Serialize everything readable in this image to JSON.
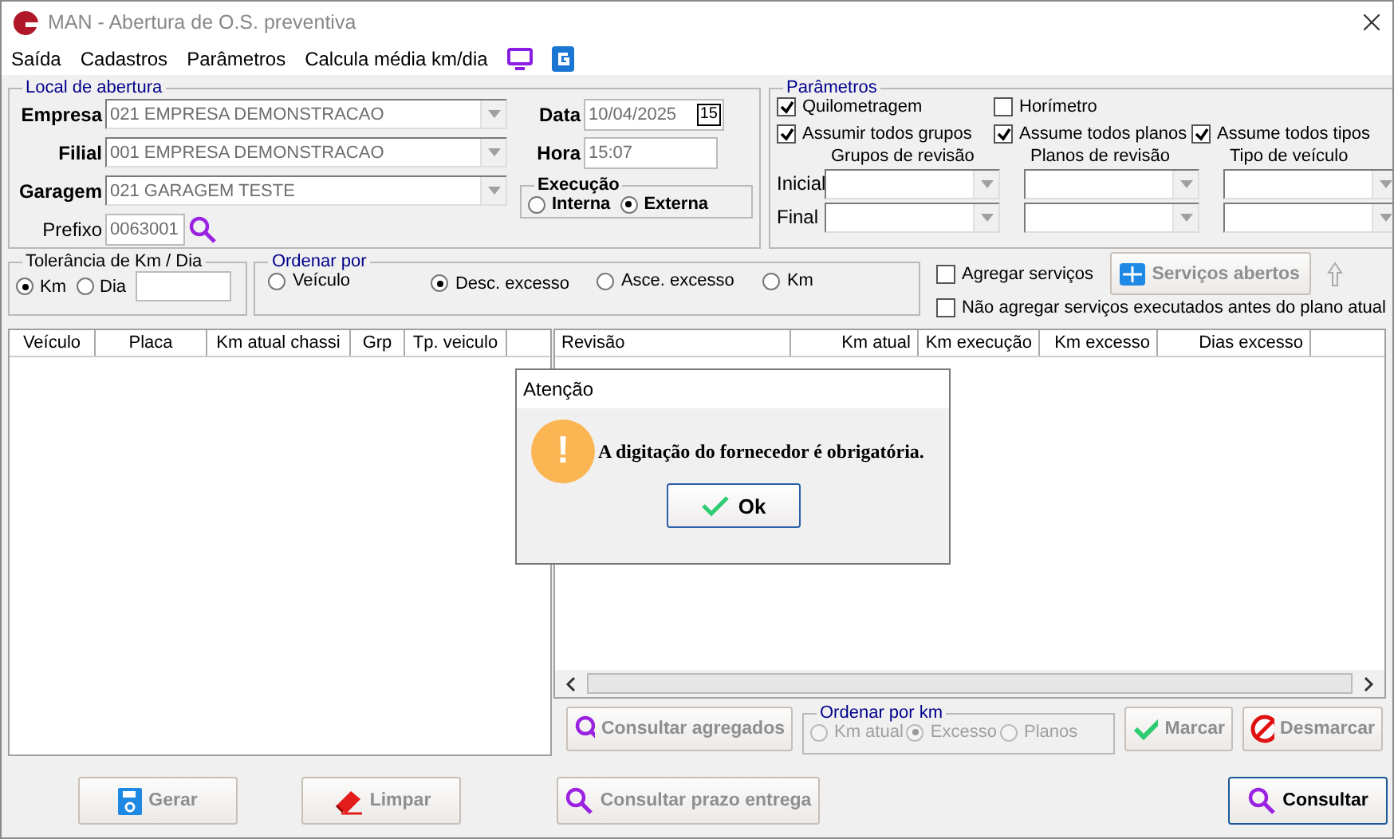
{
  "window": {
    "title": "MAN - Abertura de O.S. preventiva"
  },
  "menu": [
    "Saída",
    "Cadastros",
    "Parâmetros",
    "Calcula média km/dia"
  ],
  "local": {
    "title": "Local de abertura",
    "fields": [
      {
        "label": "Empresa",
        "value": "021 EMPRESA DEMONSTRACAO"
      },
      {
        "label": "Filial",
        "value": "001 EMPRESA DEMONSTRACAO"
      },
      {
        "label": "Garagem",
        "value": "021 GARAGEM TESTE"
      }
    ],
    "prefixo": {
      "label": "Prefixo",
      "value": "0063001"
    },
    "data": {
      "label": "Data",
      "value": "10/04/2025",
      "calendar": "15"
    },
    "hora": {
      "label": "Hora",
      "value": "15:07"
    },
    "execucao": {
      "title": "Execução",
      "options": [
        {
          "label": "Interna",
          "selected": false
        },
        {
          "label": "Externa",
          "selected": true
        }
      ]
    }
  },
  "parametros": {
    "title": "Parâmetros",
    "checks": [
      {
        "label": "Quilometragem",
        "checked": true
      },
      {
        "label": "Horímetro",
        "checked": false
      },
      {
        "label": "Assumir todos grupos",
        "checked": true
      },
      {
        "label": "Assume todos planos",
        "checked": true
      },
      {
        "label": "Assume todos tipos",
        "checked": true
      }
    ],
    "columns": [
      "Grupos de revisão",
      "Planos de revisão",
      "Tipo de veículo"
    ],
    "rows": [
      "Inicial",
      "Final"
    ]
  },
  "tolerancia": {
    "title": "Tolerância de Km / Dia",
    "options": [
      {
        "label": "Km",
        "selected": true
      },
      {
        "label": "Dia",
        "selected": false
      }
    ]
  },
  "ordenar": {
    "title": "Ordenar por",
    "options": [
      {
        "label": "Veículo",
        "selected": false
      },
      {
        "label": "Desc. excesso",
        "selected": true
      },
      {
        "label": "Asce. excesso",
        "selected": false
      },
      {
        "label": "Km",
        "selected": false
      }
    ]
  },
  "agregar": [
    {
      "label": "Agregar serviços",
      "checked": false
    },
    {
      "label": "Não agregar serviços executados antes do plano atual",
      "checked": false
    }
  ],
  "servicos_button": {
    "label": "Serviços abertos",
    "disabled": true
  },
  "left_table": {
    "columns": [
      "Veículo",
      "Placa",
      "Km atual chassi",
      "Grp",
      "Tp. veiculo"
    ]
  },
  "right_table": {
    "columns": [
      "Revisão",
      "Km atual",
      "Km execução",
      "Km excesso",
      "Dias excesso"
    ]
  },
  "consultar_agregados": {
    "label": "Consultar agregados",
    "disabled": true
  },
  "ordenar_km": {
    "title": "Ordenar por km",
    "disabled": true,
    "options": [
      {
        "label": "Km atual",
        "selected": false
      },
      {
        "label": "Excesso",
        "selected": true
      },
      {
        "label": "Planos",
        "selected": false
      }
    ]
  },
  "marcar": {
    "label": "Marcar",
    "disabled": true
  },
  "desmarcar": {
    "label": "Desmarcar",
    "disabled": true
  },
  "footer": [
    {
      "label": "Gerar",
      "kind": "save",
      "disabled": true
    },
    {
      "label": "Limpar",
      "kind": "eraser",
      "disabled": true
    },
    {
      "label": "Consultar prazo entrega",
      "kind": "search",
      "disabled": true
    },
    {
      "label": "Consultar",
      "kind": "search",
      "disabled": false
    }
  ],
  "dialog": {
    "title": "Atenção",
    "icon": "!",
    "message": "A digitação do fornecedor é obrigatória.",
    "button": "Ok"
  }
}
